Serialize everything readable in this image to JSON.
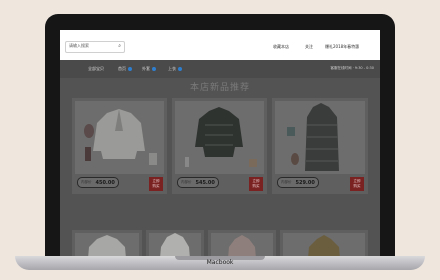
{
  "laptop": {
    "brand": "Macbook"
  },
  "topbar": {
    "search_placeholder": "请输入搜索",
    "links": [
      "收藏本店",
      "关注",
      "爆礼2018年春特惠"
    ]
  },
  "nav": {
    "items": [
      "全部宝贝",
      "首页",
      "外套",
      "上衣"
    ],
    "right_text": "客服在线时间 · 9:30 - 0:30"
  },
  "section_title": "本店新品推荐",
  "products": [
    {
      "price_tag": "内部价",
      "price": "450.00",
      "buy_label": [
        "立即",
        "购买"
      ]
    },
    {
      "price_tag": "内部价",
      "price": "545.00",
      "buy_label": [
        "立即",
        "购买"
      ]
    },
    {
      "price_tag": "内部价",
      "price": "529.00",
      "buy_label": [
        "立即",
        "购买"
      ]
    }
  ],
  "colors": {
    "overlay": "#535353",
    "buy_button": "#7a2222",
    "nav_dot": "#2f7fd0"
  }
}
